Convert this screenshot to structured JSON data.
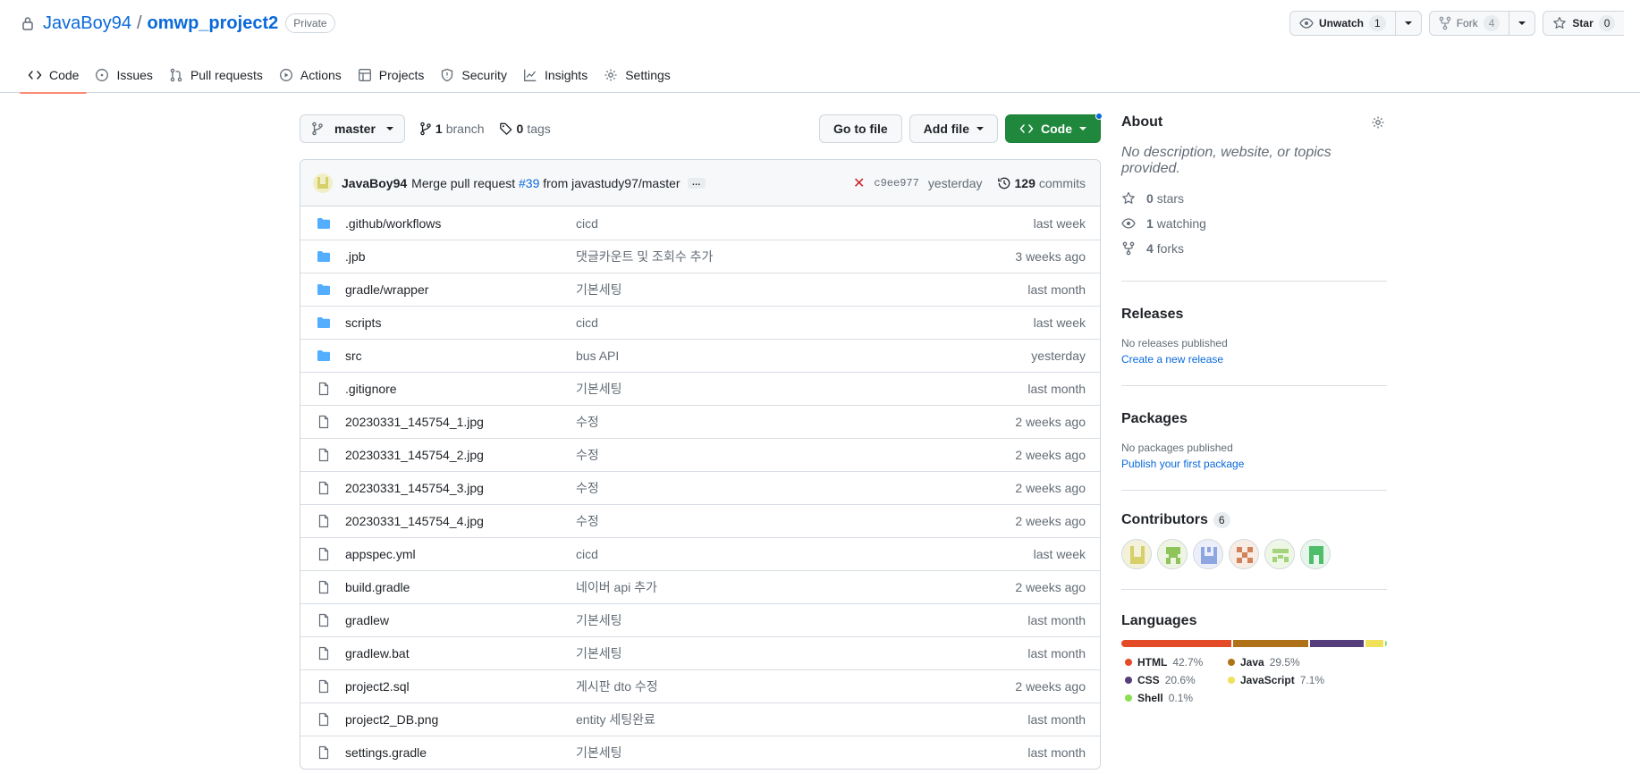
{
  "repo": {
    "owner": "JavaBoy94",
    "separator": "/",
    "name": "omwp_project2",
    "visibility": "Private"
  },
  "actions": {
    "unwatch_label": "Unwatch",
    "unwatch_count": "1",
    "fork_label": "Fork",
    "fork_count": "4",
    "star_label": "Star",
    "star_count": "0"
  },
  "tabs": [
    {
      "label": "Code",
      "icon": "code-icon"
    },
    {
      "label": "Issues",
      "icon": "issue-icon"
    },
    {
      "label": "Pull requests",
      "icon": "pull-request-icon"
    },
    {
      "label": "Actions",
      "icon": "play-icon"
    },
    {
      "label": "Projects",
      "icon": "table-icon"
    },
    {
      "label": "Security",
      "icon": "shield-icon"
    },
    {
      "label": "Insights",
      "icon": "graph-icon"
    },
    {
      "label": "Settings",
      "icon": "gear-icon"
    }
  ],
  "toolbar": {
    "branch": "master",
    "branch_count": "1",
    "branch_label": "branch",
    "tag_count": "0",
    "tag_label": "tags",
    "go_to_file": "Go to file",
    "add_file": "Add file",
    "code": "Code"
  },
  "commit": {
    "author": "JavaBoy94",
    "message_prefix": "Merge pull request",
    "pr": "#39",
    "message_suffix": "from javastudy97/master",
    "ellipsis": "…",
    "status": "✕",
    "sha": "c9ee977",
    "when": "yesterday",
    "commit_count": "129",
    "commit_label": "commits"
  },
  "files": [
    {
      "type": "dir",
      "name": ".github/workflows",
      "message": "cicd",
      "age": "last week"
    },
    {
      "type": "dir",
      "name": ".jpb",
      "message": "댓글카운트 및 조회수 추가",
      "age": "3 weeks ago"
    },
    {
      "type": "dir",
      "name": "gradle/wrapper",
      "message": "기본세팅",
      "age": "last month"
    },
    {
      "type": "dir",
      "name": "scripts",
      "message": "cicd",
      "age": "last week"
    },
    {
      "type": "dir",
      "name": "src",
      "message": "bus API",
      "age": "yesterday"
    },
    {
      "type": "file",
      "name": ".gitignore",
      "message": "기본세팅",
      "age": "last month"
    },
    {
      "type": "file",
      "name": "20230331_145754_1.jpg",
      "message": "수정",
      "age": "2 weeks ago"
    },
    {
      "type": "file",
      "name": "20230331_145754_2.jpg",
      "message": "수정",
      "age": "2 weeks ago"
    },
    {
      "type": "file",
      "name": "20230331_145754_3.jpg",
      "message": "수정",
      "age": "2 weeks ago"
    },
    {
      "type": "file",
      "name": "20230331_145754_4.jpg",
      "message": "수정",
      "age": "2 weeks ago"
    },
    {
      "type": "file",
      "name": "appspec.yml",
      "message": "cicd",
      "age": "last week"
    },
    {
      "type": "file",
      "name": "build.gradle",
      "message": "네이버 api 추가",
      "age": "2 weeks ago"
    },
    {
      "type": "file",
      "name": "gradlew",
      "message": "기본세팅",
      "age": "last month"
    },
    {
      "type": "file",
      "name": "gradlew.bat",
      "message": "기본세팅",
      "age": "last month"
    },
    {
      "type": "file",
      "name": "project2.sql",
      "message": "게시판 dto 수정",
      "age": "2 weeks ago"
    },
    {
      "type": "file",
      "name": "project2_DB.png",
      "message": "entity 세팅완료",
      "age": "last month"
    },
    {
      "type": "file",
      "name": "settings.gradle",
      "message": "기본세팅",
      "age": "last month"
    }
  ],
  "about": {
    "title": "About",
    "description": "No description, website, or topics provided.",
    "stars_count": "0",
    "stars_label": "stars",
    "watching_count": "1",
    "watching_label": "watching",
    "forks_count": "4",
    "forks_label": "forks"
  },
  "releases": {
    "title": "Releases",
    "empty": "No releases published",
    "link": "Create a new release"
  },
  "packages": {
    "title": "Packages",
    "empty": "No packages published",
    "link": "Publish your first package"
  },
  "contributors": {
    "title": "Contributors",
    "count": "6"
  },
  "languages": {
    "title": "Languages",
    "items": [
      {
        "name": "HTML",
        "percent": "42.7%",
        "color": "#e34c26"
      },
      {
        "name": "Java",
        "percent": "29.5%",
        "color": "#b07219"
      },
      {
        "name": "CSS",
        "percent": "20.6%",
        "color": "#563d7c"
      },
      {
        "name": "JavaScript",
        "percent": "7.1%",
        "color": "#f1e05a"
      },
      {
        "name": "Shell",
        "percent": "0.1%",
        "color": "#89e051"
      }
    ]
  }
}
